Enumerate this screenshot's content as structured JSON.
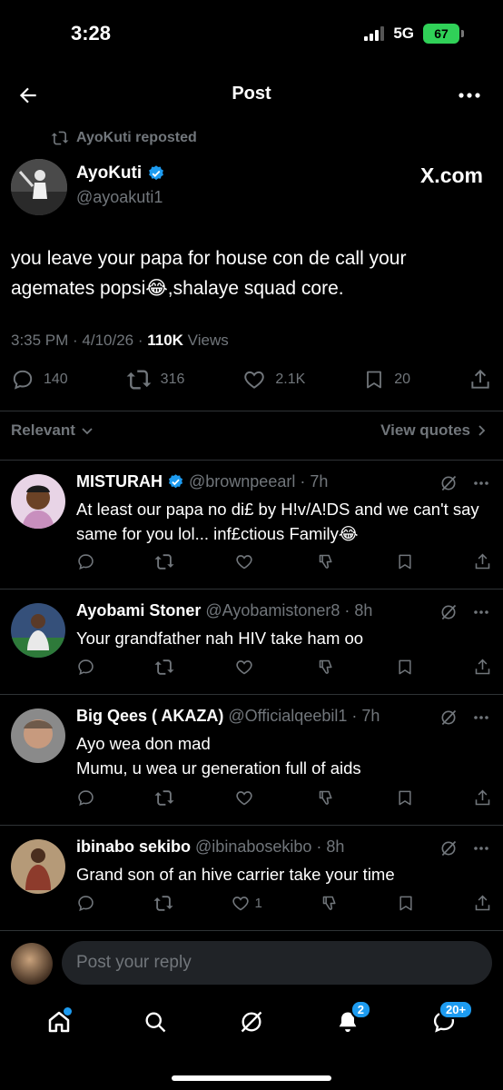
{
  "status_bar": {
    "time": "3:28",
    "network": "5G",
    "battery": "67"
  },
  "nav": {
    "title": "Post"
  },
  "post": {
    "reposted_by": "AyoKuti reposted",
    "author_name": "AyoKuti",
    "author_handle": "@ayoakuti1",
    "source_label": "X.com",
    "text": "you leave your papa for house con de call your agemates popsi😂,shalaye squad core.",
    "timestamp": "3:35 PM · 4/10/26 · ",
    "views_count": "110K",
    "views_label": " Views",
    "stats": {
      "replies": "140",
      "reposts": "316",
      "likes": "2.1K",
      "bookmarks": "20"
    }
  },
  "filter": {
    "sort_label": "Relevant",
    "quotes_label": "View quotes"
  },
  "replies": [
    {
      "name": "MISTURAH",
      "verified": true,
      "handle": "@brownpeearl",
      "time": "· 7h",
      "text": "At least our papa no di£ by H!v/A!DS and we can't say same for you lol... inf£ctious Family😂",
      "likes": ""
    },
    {
      "name": "Ayobami Stoner",
      "handle": "@Ayobamistoner8",
      "time": "· 8h",
      "text": "Your grandfather nah HIV take ham oo",
      "likes": ""
    },
    {
      "name": "Big Qees ( AKAZA)",
      "handle": "@Officialqeebil1",
      "time": "· 7h",
      "text_line1": "Ayo wea don mad",
      "text_line2": "Mumu, u wea ur generation full of aids",
      "likes": ""
    },
    {
      "name": "ibinabo sekibo",
      "handle": "@ibinabosekibo",
      "time": "· 8h",
      "text": "Grand son of an hive carrier take your time",
      "likes": "1"
    }
  ],
  "compose": {
    "placeholder": "Post your reply"
  },
  "tabbar": {
    "notifications_badge": "2",
    "messages_badge": "20+"
  },
  "colors": {
    "accent": "#1d9bf0",
    "muted": "#71767b",
    "battery": "#30d158"
  }
}
